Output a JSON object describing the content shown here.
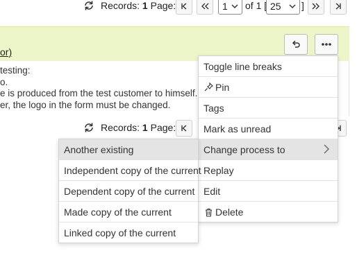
{
  "pager": {
    "records_label": "Records:",
    "records_count": "1",
    "page_label": "Page:",
    "page_value": "1",
    "of_label": "of 1",
    "bracket_open": "[",
    "page_size": "25",
    "bracket_close": "]"
  },
  "message": {
    "header_link": "or)",
    "header_link_prefix": "",
    "header_paren_close": "",
    "lines": [
      "testing:",
      "o.",
      "e is produced from the test customer to himself.",
      "er, the logo in the form must be changed."
    ]
  },
  "context_menu": {
    "items": [
      {
        "label": "Toggle line breaks",
        "icon": ""
      },
      {
        "label": "Pin",
        "icon": "pin-icon"
      },
      {
        "label": "Tags",
        "icon": ""
      },
      {
        "label": "Mark as unread",
        "icon": ""
      },
      {
        "label": "Change process to",
        "icon": "",
        "highlighted": true,
        "submenu": true
      },
      {
        "label": "Replay",
        "icon": ""
      },
      {
        "label": "Edit",
        "icon": ""
      },
      {
        "label": "Delete",
        "icon": "trash-icon"
      }
    ]
  },
  "submenu": {
    "items": [
      {
        "label": "Another existing",
        "highlighted": true
      },
      {
        "label": "Independent copy of the current"
      },
      {
        "label": "Dependent copy of the current"
      },
      {
        "label": "Made copy of the current"
      },
      {
        "label": "Linked copy of the current"
      }
    ]
  }
}
